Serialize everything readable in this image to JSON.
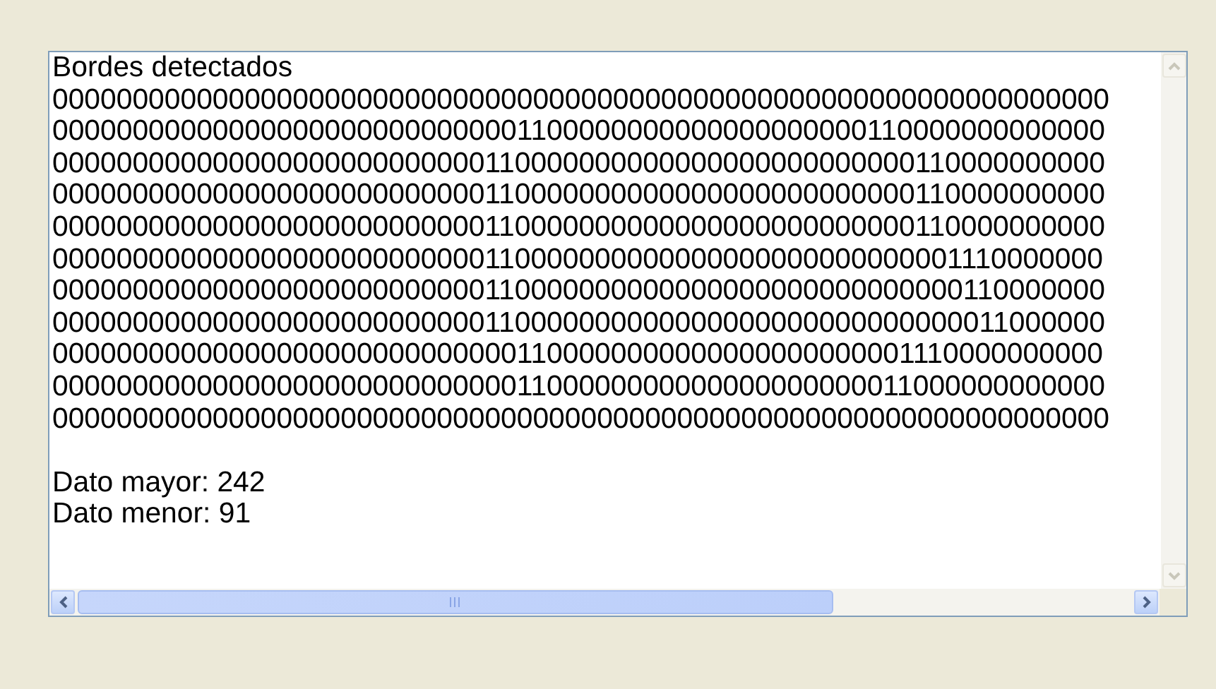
{
  "text_area": {
    "heading": "Bordes detectados",
    "rows": [
      "000000000000000000000000000000000000000000000000000000000000000000",
      "000000000000000000000000000001100000000000000000000110000000000000",
      "000000000000000000000000000110000000000000000000000000110000000000",
      "000000000000000000000000000110000000000000000000000000110000000000",
      "000000000000000000000000000110000000000000000000000000110000000000",
      "000000000000000000000000000110000000000000000000000000001110000000",
      "000000000000000000000000000110000000000000000000000000000110000000",
      "000000000000000000000000000110000000000000000000000000000011000000",
      "000000000000000000000000000001100000000000000000000001110000000000",
      "000000000000000000000000000001100000000000000000000011000000000000",
      "000000000000000000000000000000000000000000000000000000000000000000"
    ],
    "summary": [
      "Dato mayor: 242",
      "Dato menor: 91"
    ]
  }
}
